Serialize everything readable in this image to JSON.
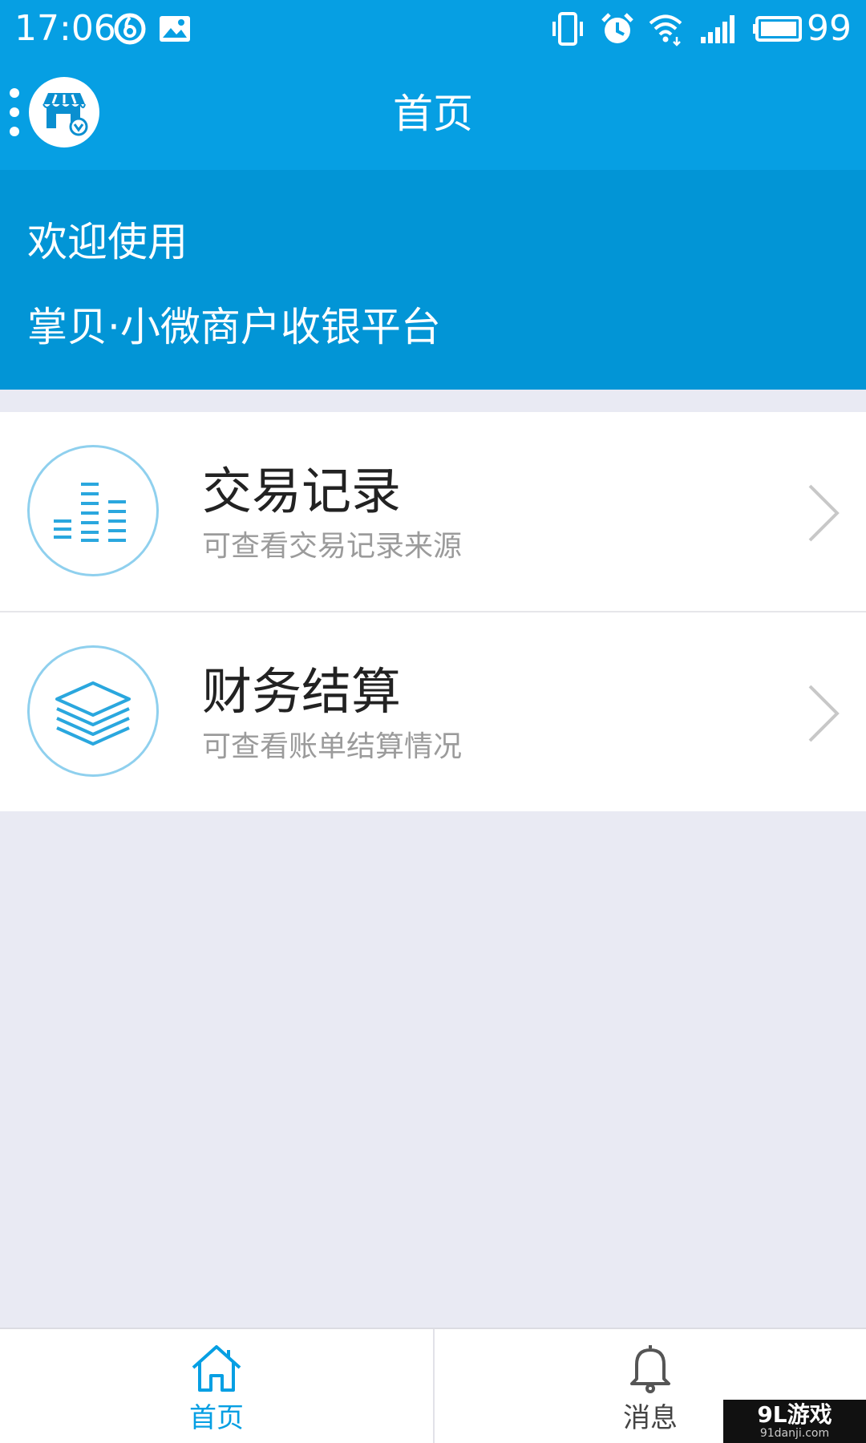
{
  "status_bar": {
    "time": "17:06",
    "battery_percent": "99",
    "icons_left": [
      "netease-music-icon",
      "gallery-icon"
    ],
    "icons_right": [
      "vibrate-icon",
      "alarm-icon",
      "wifi-icon",
      "signal-icon",
      "battery-icon"
    ]
  },
  "header": {
    "title": "首页",
    "menu_icon": "more-dots-icon",
    "avatar_icon": "shop-icon"
  },
  "welcome": {
    "line1": "欢迎使用",
    "line2": "掌贝·小微商户收银平台"
  },
  "menu_items": [
    {
      "title": "交易记录",
      "subtitle": "可查看交易记录来源",
      "icon": "bar-chart-icon"
    },
    {
      "title": "财务结算",
      "subtitle": "可查看账单结算情况",
      "icon": "layers-icon"
    }
  ],
  "bottom_nav": {
    "items": [
      {
        "label": "首页",
        "icon": "home-icon",
        "active": true
      },
      {
        "label": "消息",
        "icon": "bell-icon",
        "active": false
      }
    ]
  },
  "watermark": {
    "main": "9L游戏",
    "sub": "91danji.com"
  },
  "colors": {
    "primary": "#069fe3",
    "banner": "#0295d6",
    "background": "#e9eaf3",
    "icon_accent": "#2aa7de"
  }
}
